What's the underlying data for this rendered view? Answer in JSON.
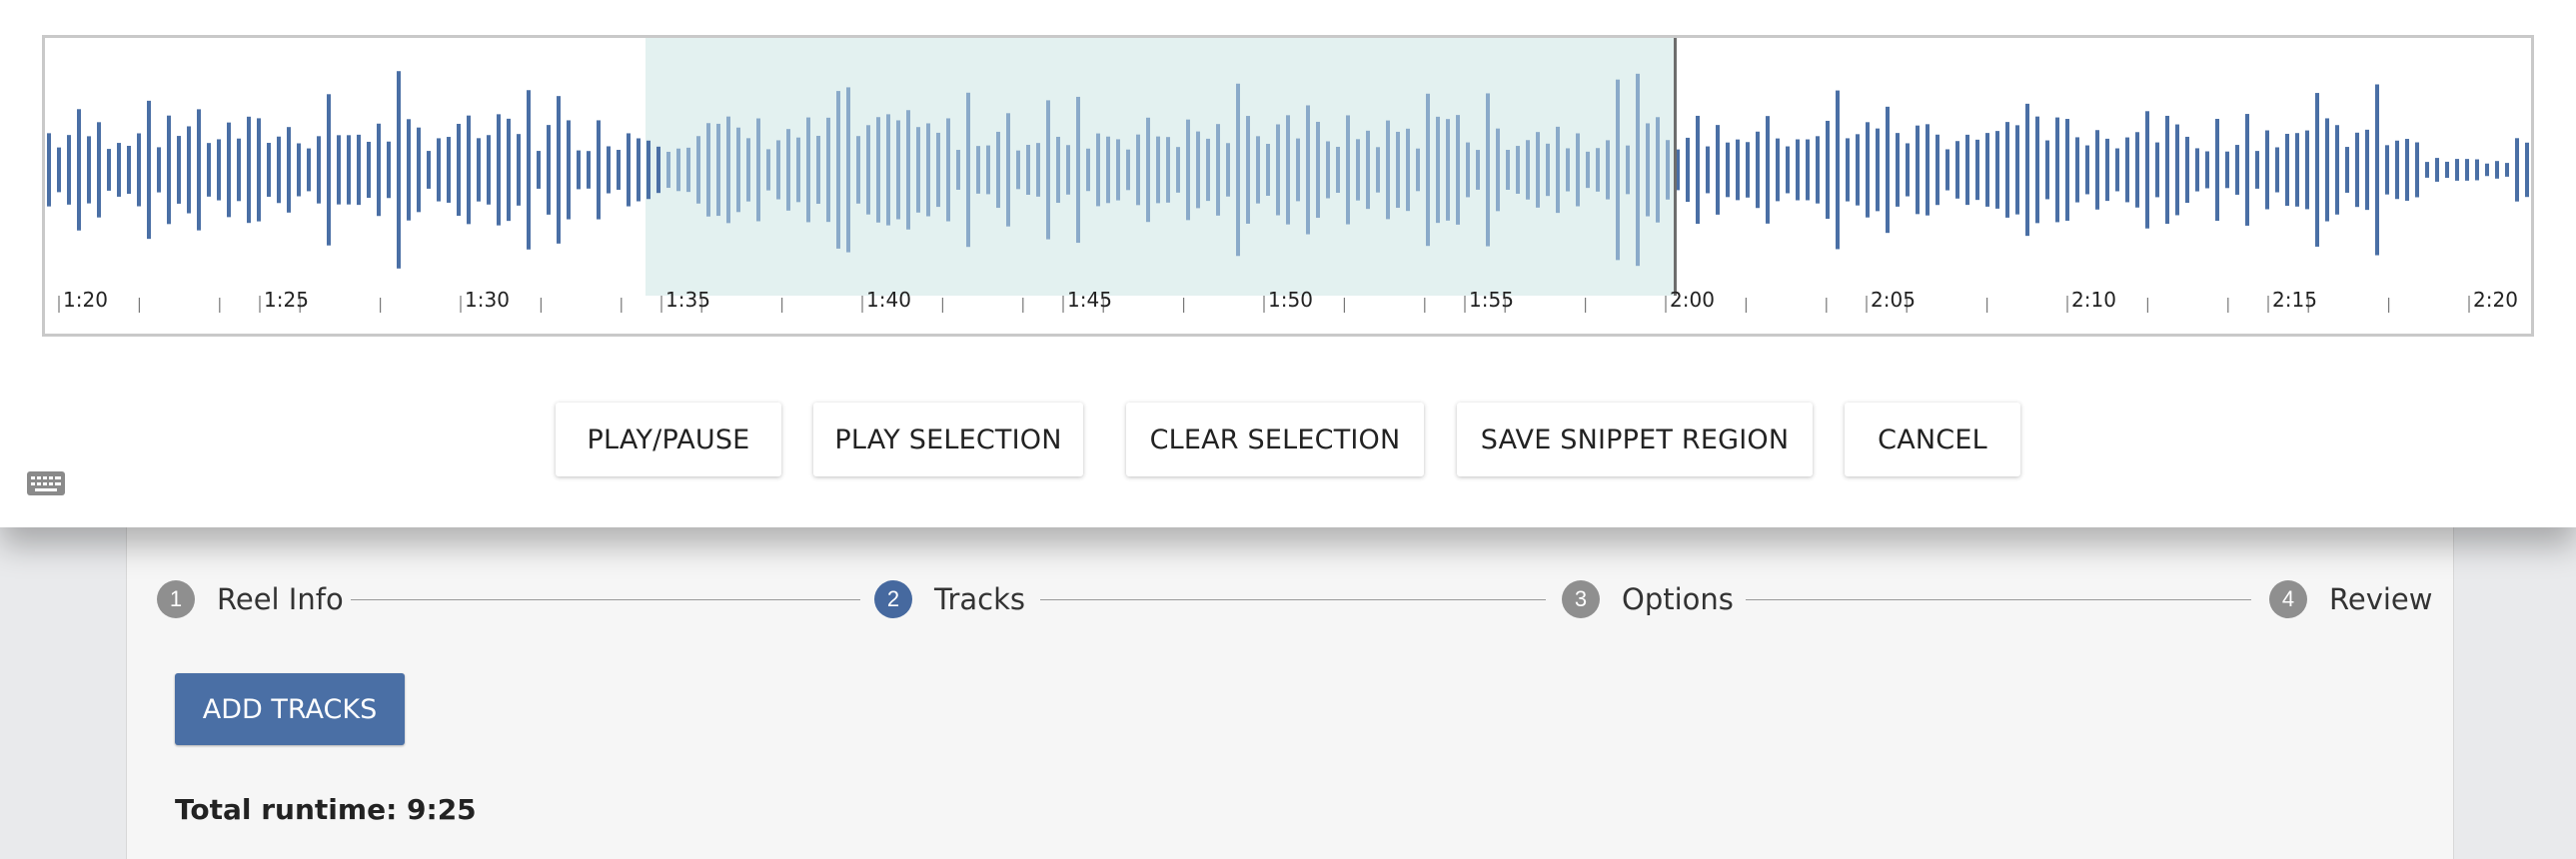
{
  "waveform": {
    "time_labels": [
      "1:20",
      "1:25",
      "1:30",
      "1:35",
      "1:40",
      "1:45",
      "1:50",
      "1:55",
      "2:00",
      "2:05",
      "2:10",
      "2:15",
      "2:20"
    ],
    "selection": {
      "start": "1:35",
      "end": "2:00"
    },
    "playhead": "2:00",
    "colors": {
      "bar": "#4a6fa5",
      "bar_selected": "#8aaac9",
      "selection_bg": "#d6ecea"
    }
  },
  "controls": {
    "play_pause": "PLAY/PAUSE",
    "play_selection": "PLAY SELECTION",
    "clear_selection": "CLEAR SELECTION",
    "save_snippet": "SAVE SNIPPET REGION",
    "cancel": "CANCEL"
  },
  "stepper": {
    "steps": [
      {
        "number": "1",
        "label": "Reel Info"
      },
      {
        "number": "2",
        "label": "Tracks"
      },
      {
        "number": "3",
        "label": "Options"
      },
      {
        "number": "4",
        "label": "Review"
      }
    ],
    "active_step": "2"
  },
  "page": {
    "add_tracks_label": "ADD TRACKS",
    "runtime_text": "Total runtime: 9:25"
  },
  "icons": {
    "keyboard": "keyboard-icon"
  }
}
